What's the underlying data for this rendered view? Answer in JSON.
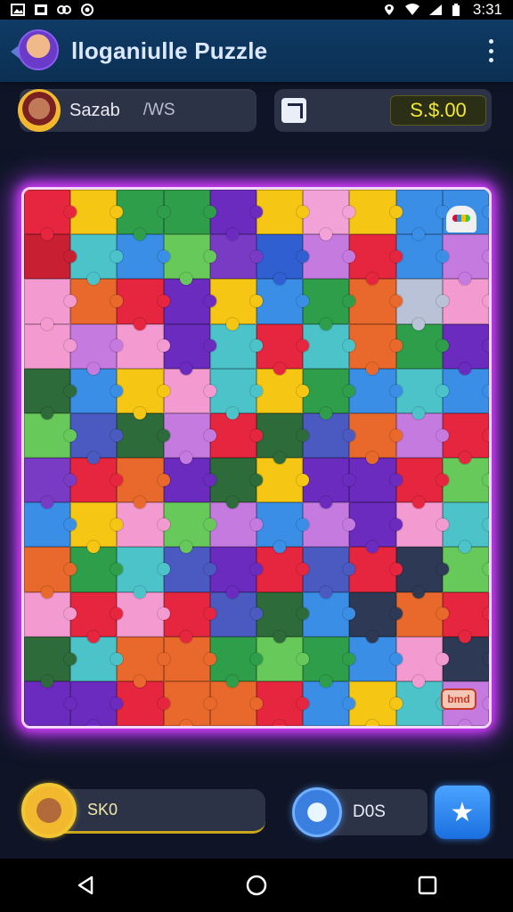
{
  "status_bar": {
    "time": "3:31",
    "left_icons": [
      "image-icon",
      "image-icon",
      "link-icon",
      "record-icon"
    ],
    "right_icons": [
      "location-icon",
      "wifi-icon",
      "signal-icon",
      "battery-icon"
    ]
  },
  "app_bar": {
    "title": "lloganiulle Puzzle",
    "back_icon": "back-arrow-icon",
    "menu_icon": "kebab-menu-icon"
  },
  "player": {
    "name": "Sazab",
    "tag": "/WS"
  },
  "coins": {
    "icon": "expand-icon",
    "value": "S.$.00"
  },
  "board": {
    "columns": 10,
    "rows": 12,
    "badge": "bmd",
    "piece_colors": [
      [
        "#e6263f",
        "#f5c613",
        "#2e9e4a",
        "#2e9e4a",
        "#6b2bbf",
        "#f5c613",
        "#f2a2d6",
        "#f5c613",
        "#3a8ee6",
        "#3a8ee6"
      ],
      [
        "#c81f33",
        "#4cc3c8",
        "#3a8ee6",
        "#66c95a",
        "#7a3bc4",
        "#2f5fd0",
        "#c57ae0",
        "#e6263f",
        "#3a8ee6",
        "#c57ae0"
      ],
      [
        "#f39bd0",
        "#e8692b",
        "#e6263f",
        "#6b2bbf",
        "#f5c613",
        "#3a8ee6",
        "#2e9e4a",
        "#e8692b",
        "#b9c2d6",
        "#f39bd0"
      ],
      [
        "#f39bd0",
        "#c57ae0",
        "#f39bd0",
        "#6b2bbf",
        "#4cc3c8",
        "#e6263f",
        "#4cc3c8",
        "#e8692b",
        "#2e9e4a",
        "#6b2bbf"
      ],
      [
        "#2e6b3a",
        "#3a8ee6",
        "#f5c613",
        "#f39bd0",
        "#4cc3c8",
        "#f5c613",
        "#2e9e4a",
        "#3a8ee6",
        "#4cc3c8",
        "#3a8ee6"
      ],
      [
        "#66c95a",
        "#4a5ac0",
        "#2e6b3a",
        "#c57ae0",
        "#e6263f",
        "#2e6b3a",
        "#4a5ac0",
        "#e8692b",
        "#c57ae0",
        "#e6263f"
      ],
      [
        "#7a3bc4",
        "#e6263f",
        "#e8692b",
        "#6b2bbf",
        "#2e6b3a",
        "#f5c613",
        "#6b2bbf",
        "#6b2bbf",
        "#e6263f",
        "#66c95a"
      ],
      [
        "#3a8ee6",
        "#f5c613",
        "#f39bd0",
        "#66c95a",
        "#c57ae0",
        "#3a8ee6",
        "#c57ae0",
        "#6b2bbf",
        "#f39bd0",
        "#4cc3c8"
      ],
      [
        "#e8692b",
        "#2e9e4a",
        "#4cc3c8",
        "#4a5ac0",
        "#6b2bbf",
        "#e6263f",
        "#4a5ac0",
        "#e6263f",
        "#2e3a55",
        "#66c95a"
      ],
      [
        "#f39bd0",
        "#e6263f",
        "#f39bd0",
        "#e6263f",
        "#4a5ac0",
        "#2e6b3a",
        "#3a8ee6",
        "#2e3a55",
        "#e8692b",
        "#e6263f"
      ],
      [
        "#2e6b3a",
        "#4cc3c8",
        "#e8692b",
        "#e8692b",
        "#2e9e4a",
        "#66c95a",
        "#2e9e4a",
        "#3a8ee6",
        "#f39bd0",
        "#2e3a55"
      ],
      [
        "#6b2bbf",
        "#6b2bbf",
        "#e6263f",
        "#e8692b",
        "#e8692b",
        "#e6263f",
        "#3a8ee6",
        "#f5c613",
        "#4cc3c8",
        "#c57ae0"
      ]
    ]
  },
  "hint": {
    "label": "SK0"
  },
  "bonus": {
    "label": "D0S"
  },
  "star_button": {
    "glyph": "★"
  },
  "nav": {
    "back": "back-triangle-icon",
    "home": "home-circle-icon",
    "recents": "recents-square-icon"
  }
}
